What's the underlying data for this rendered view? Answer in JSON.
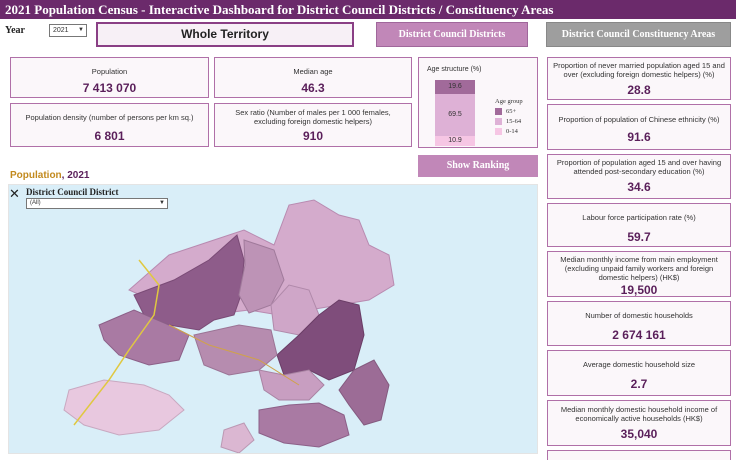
{
  "header": {
    "title": "2021 Population Census - Interactive Dashboard for District Council Districts / Constituency Areas"
  },
  "year": {
    "label": "Year",
    "selected": "2021"
  },
  "nav": {
    "whole_territory": "Whole Territory",
    "district_council_districts": "District Council Districts",
    "district_council_constituency_areas": "District Council Constituency Areas"
  },
  "stats": {
    "population": {
      "label": "Population",
      "value": "7 413 070"
    },
    "median_age": {
      "label": "Median age",
      "value": "46.3"
    },
    "density": {
      "label": "Population density (number of persons per km sq.)",
      "value": "6 801"
    },
    "sex_ratio": {
      "label": "Sex ratio (Number of males per 1 000 females, excluding foreign domestic helpers)",
      "value": "910"
    }
  },
  "age_structure": {
    "title": "Age structure (%)",
    "legend_title": "Age group",
    "groups": [
      {
        "label": "65+",
        "value": "19.6",
        "color": "#a16a9a"
      },
      {
        "label": "15-64",
        "value": "69.5",
        "color": "#deb1d6"
      },
      {
        "label": "0-14",
        "value": "10.9",
        "color": "#f6c6e4"
      }
    ]
  },
  "show_ranking": "Show Ranking",
  "map": {
    "heading_accent": "Population",
    "heading_year": ", 2021",
    "filter_label": "District Council District",
    "filter_value": "(All)"
  },
  "right_panel": [
    {
      "label": "Proportion of never married population aged 15 and over (excluding foreign domestic helpers) (%)",
      "value": "28.8"
    },
    {
      "label": "Proportion of population of Chinese ethnicity (%)",
      "value": "91.6"
    },
    {
      "label": "Proportion of population aged 15 and over having attended post-secondary education (%)",
      "value": "34.6"
    },
    {
      "label": "Labour force participation rate (%)",
      "value": "59.7"
    },
    {
      "label": "Median monthly income from main employment (excluding unpaid family workers and foreign domestic helpers) (HK$)",
      "value": "19,500"
    },
    {
      "label": "Number of domestic households",
      "value": "2 674 161"
    },
    {
      "label": "Average domestic household size",
      "value": "2.7"
    },
    {
      "label": "Median monthly domestic household income of economically active households (HK$)",
      "value": "35,040"
    }
  ]
}
